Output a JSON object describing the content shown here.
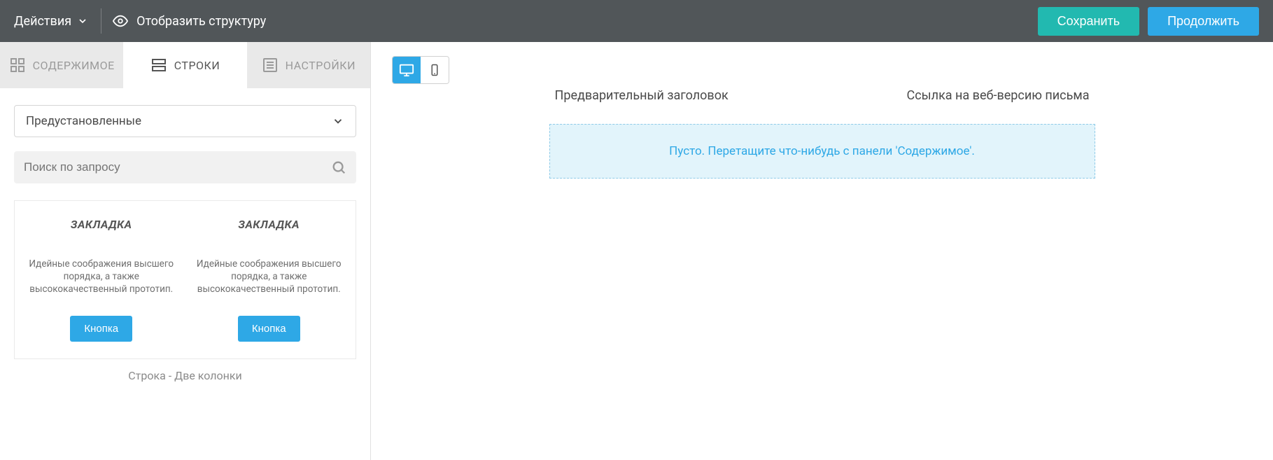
{
  "topbar": {
    "actions_label": "Действия",
    "show_structure": "Отобразить структуру",
    "save": "Сохранить",
    "continue": "Продолжить"
  },
  "tabs": {
    "content": "СОДЕРЖИМОЕ",
    "rows": "СТРОКИ",
    "settings": "НАСТРОЙКИ"
  },
  "sidebar": {
    "preset_label": "Предустановленные",
    "search_placeholder": "Поиск по запросу"
  },
  "row_template": {
    "col_title": "ЗАКЛАДКА",
    "col_body": "Идейные соображения высшего порядка, а также высококачественный прототип.",
    "col_button": "Кнопка",
    "label": "Строка - Две колонки"
  },
  "preview": {
    "preheader": "Предварительный заголовок",
    "webversion": "Ссылка на веб-версию письма",
    "dropzone_text": "Пусто. Перетащите что-нибудь с панели 'Содержимое'."
  },
  "colors": {
    "accent_teal": "#22b9b0",
    "accent_blue": "#2ea8e6",
    "topbar_bg": "#515659"
  }
}
